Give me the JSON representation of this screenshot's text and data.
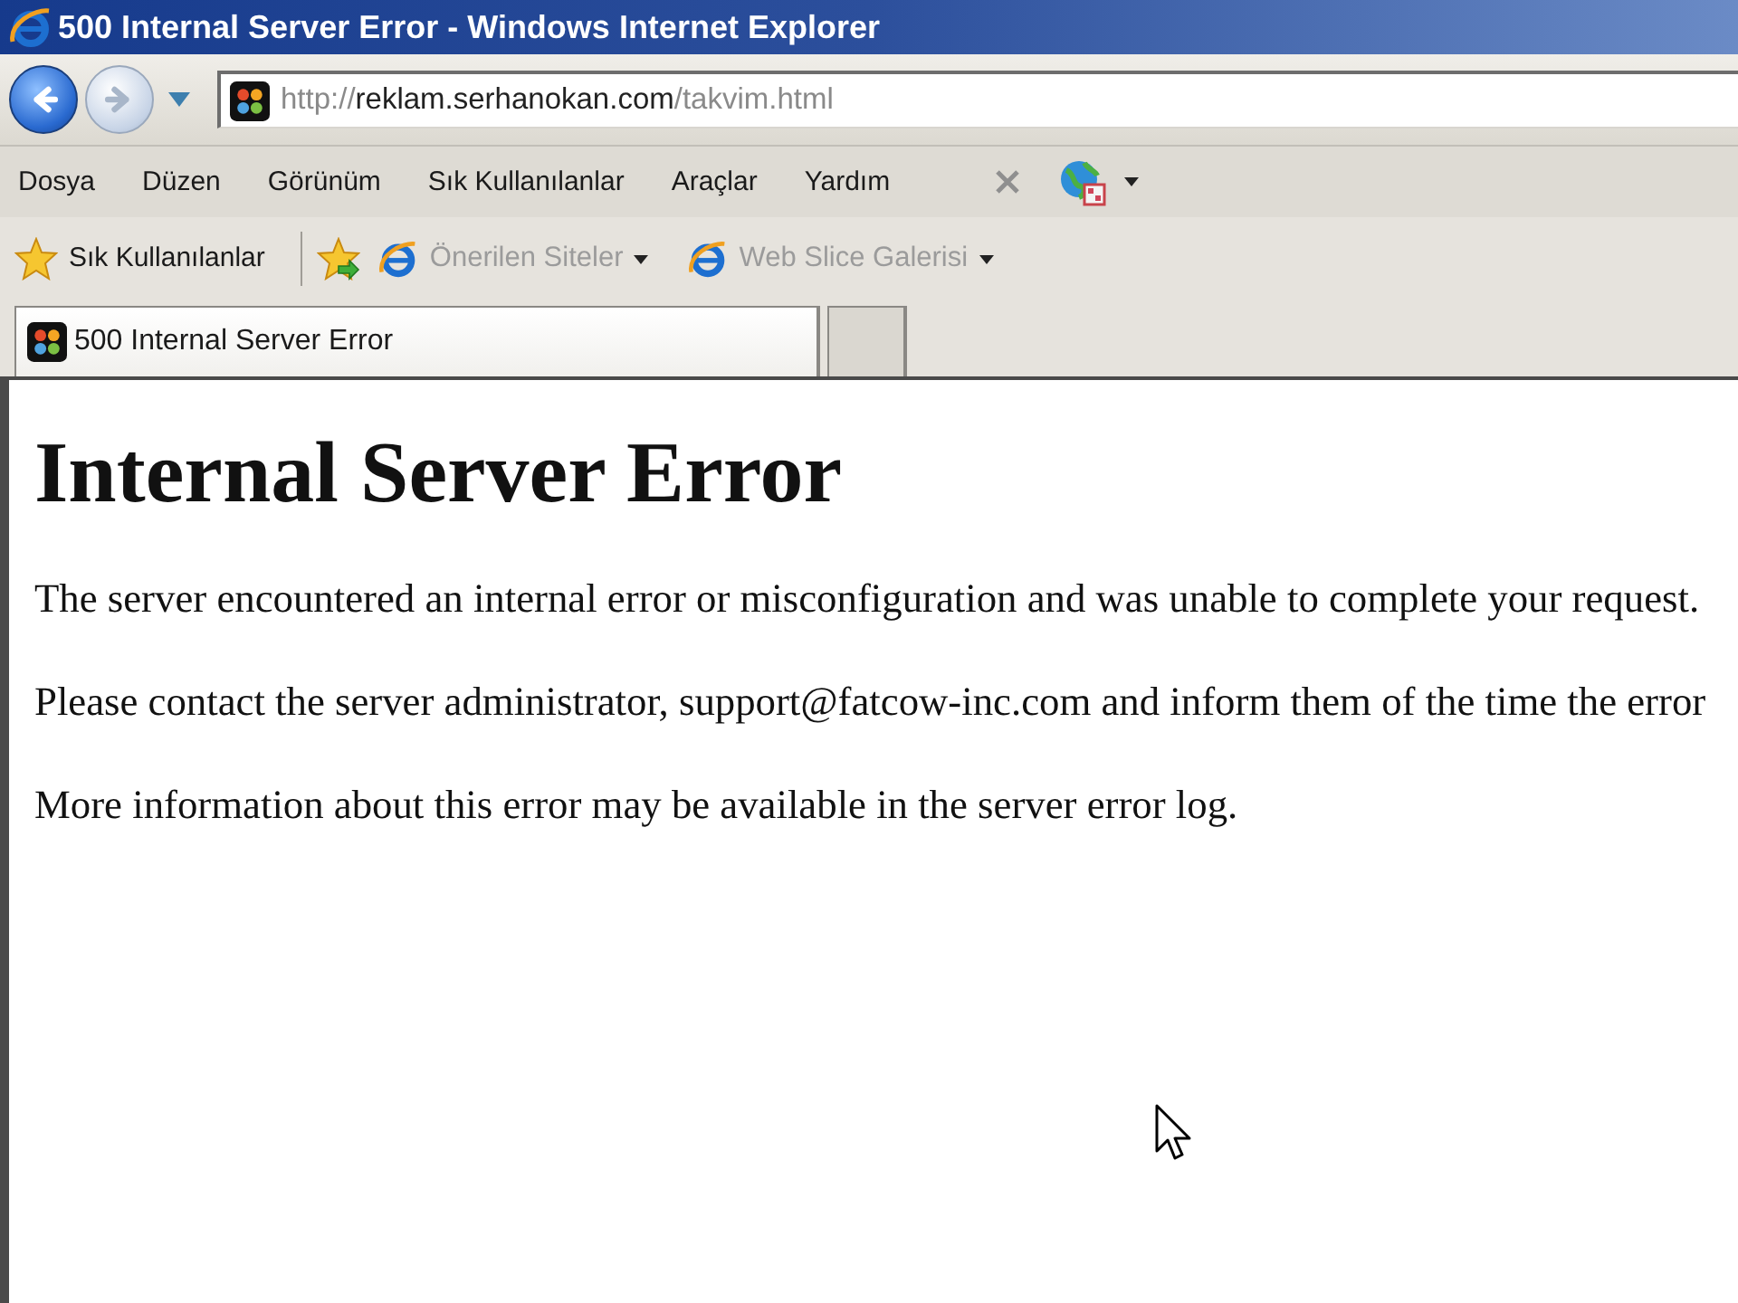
{
  "window": {
    "title": "500 Internal Server Error - Windows Internet Explorer"
  },
  "navigation": {
    "back": {
      "disabled": false
    },
    "forward": {
      "disabled": true
    }
  },
  "address_bar": {
    "url_scheme": "http://",
    "url_host": "reklam.serhanokan.com",
    "url_path": "/takvim.html"
  },
  "menu_bar": {
    "items": [
      "Dosya",
      "Düzen",
      "Görünüm",
      "Sık Kullanılanlar",
      "Araçlar",
      "Yardım"
    ]
  },
  "favorites_bar": {
    "favorites_label": "Sık Kullanılanlar",
    "links": [
      {
        "label": "Önerilen Siteler",
        "disabled": true
      },
      {
        "label": "Web Slice Galerisi",
        "disabled": true
      }
    ]
  },
  "tabs": [
    {
      "label": "500 Internal Server Error",
      "selected": true
    }
  ],
  "page": {
    "heading": "Internal Server Error",
    "paragraphs": [
      "The server encountered an internal error or misconfiguration and was unable to complete your request.",
      "Please contact the server administrator, support@fatcow-inc.com and inform them of the time the error",
      "More information about this error may be available in the server error log."
    ]
  }
}
